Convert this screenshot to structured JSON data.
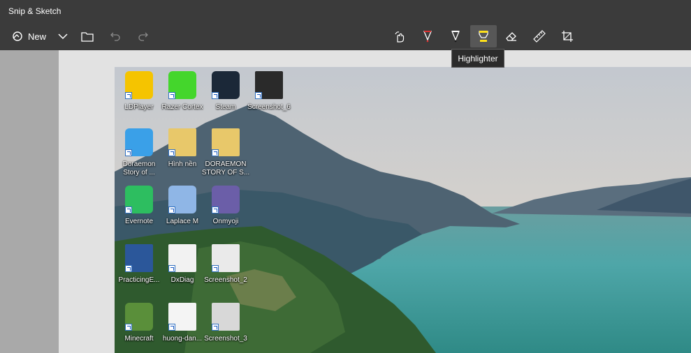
{
  "app": {
    "title": "Snip & Sketch"
  },
  "toolbar": {
    "new_label": "New",
    "tools": [
      {
        "name": "touch-writing"
      },
      {
        "name": "ballpoint-pen"
      },
      {
        "name": "pencil"
      },
      {
        "name": "highlighter",
        "active": true
      },
      {
        "name": "eraser"
      },
      {
        "name": "ruler"
      },
      {
        "name": "crop"
      }
    ]
  },
  "tooltip": {
    "text": "Highlighter"
  },
  "desktop": {
    "icons": [
      {
        "label": "LDPlayer",
        "color": "#f5c400",
        "icon": "ldplayer-icon"
      },
      {
        "label": "Razer Cortex",
        "color": "#44d62c",
        "icon": "razer-cortex-icon"
      },
      {
        "label": "Steam",
        "color": "#1b2838",
        "icon": "steam-icon"
      },
      {
        "label": "Screenshot_6",
        "color": "#2a2a2a",
        "icon": "image-file-icon"
      },
      {
        "label": "Doraemon Story of ...",
        "color": "#3aa0e8",
        "icon": "doraemon-icon"
      },
      {
        "label": "Hình nền",
        "color": "#e8c86a",
        "icon": "folder-icon"
      },
      {
        "label": "DORAEMON STORY OF S...",
        "color": "#e8c86a",
        "icon": "folder-icon"
      },
      {
        "label": "Evernote",
        "color": "#2dbe60",
        "icon": "evernote-icon"
      },
      {
        "label": "Laplace M",
        "color": "#8fb6e6",
        "icon": "laplace-m-icon"
      },
      {
        "label": "Onmyoji",
        "color": "#6b5ea8",
        "icon": "onmyoji-icon"
      },
      {
        "label": "PracticingE...",
        "color": "#2b579a",
        "icon": "word-document-icon"
      },
      {
        "label": "DxDiag",
        "color": "#f2f2f2",
        "icon": "text-file-icon"
      },
      {
        "label": "Screenshot_2",
        "color": "#eaeaea",
        "icon": "image-file-icon"
      },
      {
        "label": "Minecraft",
        "color": "#5a8f3a",
        "icon": "minecraft-icon"
      },
      {
        "label": "huong-dan...",
        "color": "#f4f4f4",
        "icon": "image-file-icon"
      },
      {
        "label": "Screenshot_3",
        "color": "#d8d8d8",
        "icon": "image-file-icon"
      }
    ]
  }
}
